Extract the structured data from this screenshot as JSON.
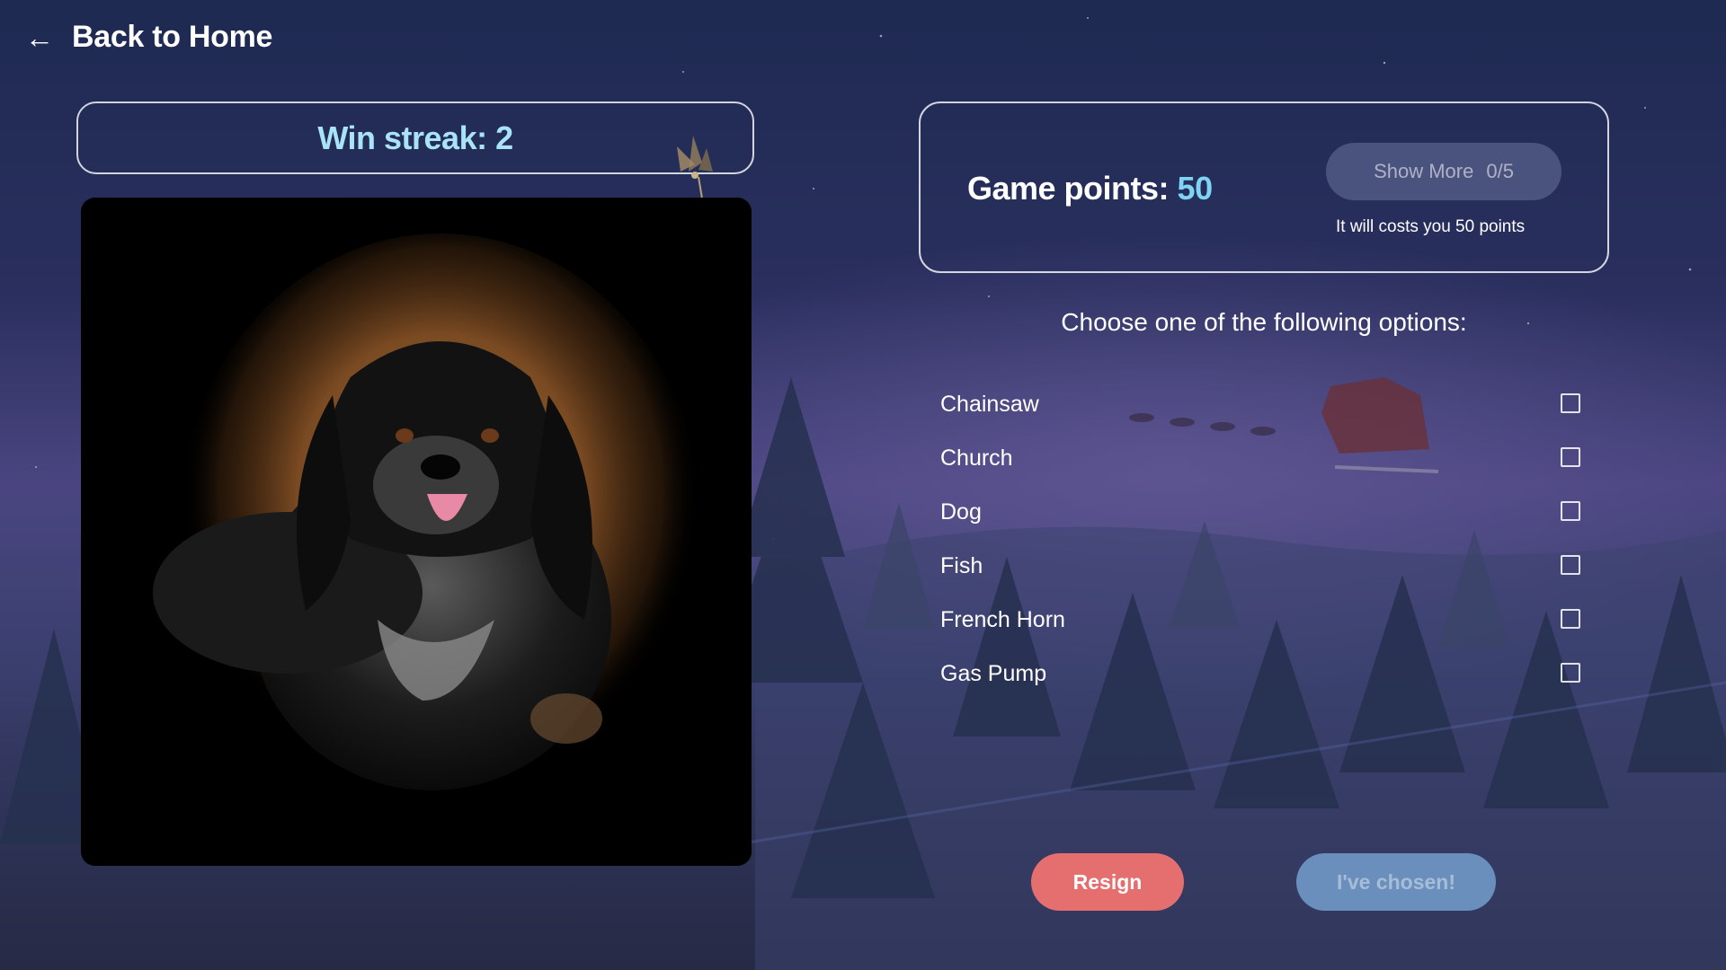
{
  "nav": {
    "back_label": "Back to Home",
    "back_icon": "arrow-left-icon"
  },
  "streak": {
    "label": "Win streak: 2"
  },
  "image": {
    "subject": "black and white spaniel dog photo with vignette"
  },
  "points": {
    "label": "Game points:",
    "value": "50",
    "show_more_label": "Show More",
    "show_more_count": "0/5",
    "cost_note": "It will costs you 50 points"
  },
  "prompt": "Choose one of the following options:",
  "options": [
    {
      "label": "Chainsaw",
      "checked": false
    },
    {
      "label": "Church",
      "checked": false
    },
    {
      "label": "Dog",
      "checked": false
    },
    {
      "label": "Fish",
      "checked": false
    },
    {
      "label": "French Horn",
      "checked": false
    },
    {
      "label": "Gas Pump",
      "checked": false
    }
  ],
  "actions": {
    "resign_label": "Resign",
    "chosen_label": "I've chosen!"
  },
  "colors": {
    "accent": "#7fd3f3",
    "streak": "#a9e3f7",
    "resign": "#e56f6f",
    "chosen": "#6b8fbc"
  }
}
